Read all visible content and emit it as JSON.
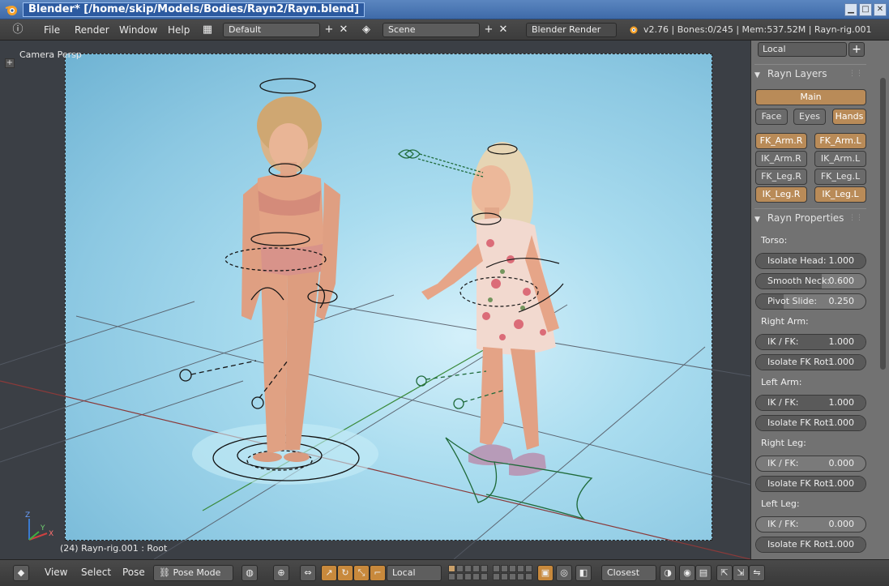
{
  "window": {
    "title": "Blender* [/home/skip/Models/Bodies/Rayn2/Rayn.blend]",
    "minimize": "▁",
    "maximize": "□",
    "close": "✕"
  },
  "info_header": {
    "menus": [
      "File",
      "Render",
      "Window",
      "Help"
    ],
    "screen_layout": "Default",
    "scene": "Scene",
    "render_engine": "Blender Render",
    "stats": "v2.76 | Bones:0/245 | Mem:537.52M | Rayn-rig.001"
  },
  "viewport": {
    "view_label": "Camera Persp",
    "object_label": "(24) Rayn-rig.001 : Root",
    "axes": {
      "x": "X",
      "y": "Y",
      "z": "Z"
    }
  },
  "panel": {
    "space_select": "Local",
    "layers_title": "Rayn Layers",
    "layer_buttons": [
      {
        "label": "Main",
        "active": true
      },
      {
        "label": "Face",
        "active": false
      },
      {
        "label": "Eyes",
        "active": false
      },
      {
        "label": "Hands",
        "active": true
      },
      {
        "label": "FK_Arm.R",
        "active": true
      },
      {
        "label": "FK_Arm.L",
        "active": true
      },
      {
        "label": "IK_Arm.R",
        "active": false
      },
      {
        "label": "IK_Arm.L",
        "active": false
      },
      {
        "label": "FK_Leg.R",
        "active": false
      },
      {
        "label": "FK_Leg.L",
        "active": false
      },
      {
        "label": "IK_Leg.R",
        "active": true
      },
      {
        "label": "IK_Leg.L",
        "active": true
      }
    ],
    "properties_title": "Rayn Properties",
    "groups": [
      {
        "label": "Torso:",
        "sliders": [
          {
            "name": "Isolate Head:",
            "value": "1.000",
            "fraction": 1.0
          },
          {
            "name": "Smooth Neck:",
            "value": "0.600",
            "fraction": 0.6
          },
          {
            "name": "Pivot Slide:",
            "value": "0.250",
            "fraction": 0.25
          }
        ]
      },
      {
        "label": "Right Arm:",
        "sliders": [
          {
            "name": "IK / FK:",
            "value": "1.000",
            "fraction": 1.0
          },
          {
            "name": "Isolate FK Rot:",
            "value": "1.000",
            "fraction": 1.0
          }
        ]
      },
      {
        "label": "Left Arm:",
        "sliders": [
          {
            "name": "IK / FK:",
            "value": "1.000",
            "fraction": 1.0
          },
          {
            "name": "Isolate FK Rot:",
            "value": "1.000",
            "fraction": 1.0
          }
        ]
      },
      {
        "label": "Right Leg:",
        "sliders": [
          {
            "name": "IK / FK:",
            "value": "0.000",
            "fraction": 0.0
          },
          {
            "name": "Isolate FK Rot:",
            "value": "1.000",
            "fraction": 1.0
          }
        ]
      },
      {
        "label": "Left Leg:",
        "sliders": [
          {
            "name": "IK / FK:",
            "value": "0.000",
            "fraction": 0.0
          },
          {
            "name": "Isolate FK Rot:",
            "value": "1.000",
            "fraction": 1.0
          }
        ]
      }
    ]
  },
  "bottom_header": {
    "menus": [
      "View",
      "Select",
      "Pose"
    ],
    "mode": "Pose Mode",
    "transform_orientation": "Local",
    "snap_target": "Closest"
  },
  "colors": {
    "accent_orange": "#c8893c",
    "layer_active": "#b98b58",
    "titlebar_blue": "#3e6aa8",
    "rig_green": "#1f6a3a"
  }
}
